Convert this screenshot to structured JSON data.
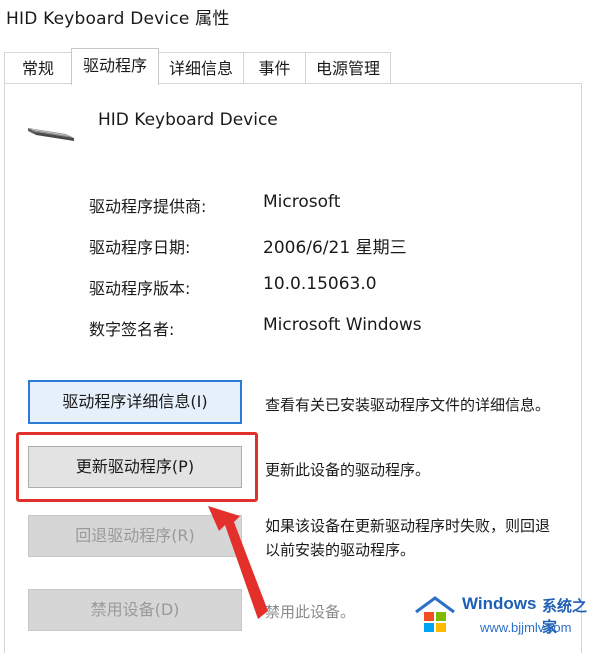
{
  "window": {
    "title": "HID Keyboard Device 属性"
  },
  "tabs": [
    {
      "label": "常规",
      "active": false
    },
    {
      "label": "驱动程序",
      "active": true
    },
    {
      "label": "详细信息",
      "active": false
    },
    {
      "label": "事件",
      "active": false
    },
    {
      "label": "电源管理",
      "active": false
    }
  ],
  "device": {
    "name": "HID Keyboard Device",
    "icon": "keyboard-icon"
  },
  "info": [
    {
      "label": "驱动程序提供商:",
      "value": "Microsoft"
    },
    {
      "label": "驱动程序日期:",
      "value": "2006/6/21 星期三"
    },
    {
      "label": "驱动程序版本:",
      "value": "10.0.15063.0"
    },
    {
      "label": "数字签名者:",
      "value": "Microsoft Windows"
    }
  ],
  "buttons": [
    {
      "label": "驱动程序详细信息(I)",
      "desc": "查看有关已安装驱动程序文件的详细信息。",
      "enabled": true
    },
    {
      "label": "更新驱动程序(P)",
      "desc": "更新此设备的驱动程序。",
      "enabled": true
    },
    {
      "label": "回退驱动程序(R)",
      "desc_line1": "如果该设备在更新驱动程序时失败，则回退",
      "desc_line2": "以前安装的驱动程序。",
      "enabled": false
    },
    {
      "label": "禁用设备(D)",
      "desc": "禁用此设备。",
      "enabled": false
    }
  ],
  "annotation": {
    "highlight_color": "#e3302a"
  },
  "watermark": {
    "brand": "Windows",
    "brand_cn": "系统之家",
    "url": "www.bjjmlv.com"
  }
}
